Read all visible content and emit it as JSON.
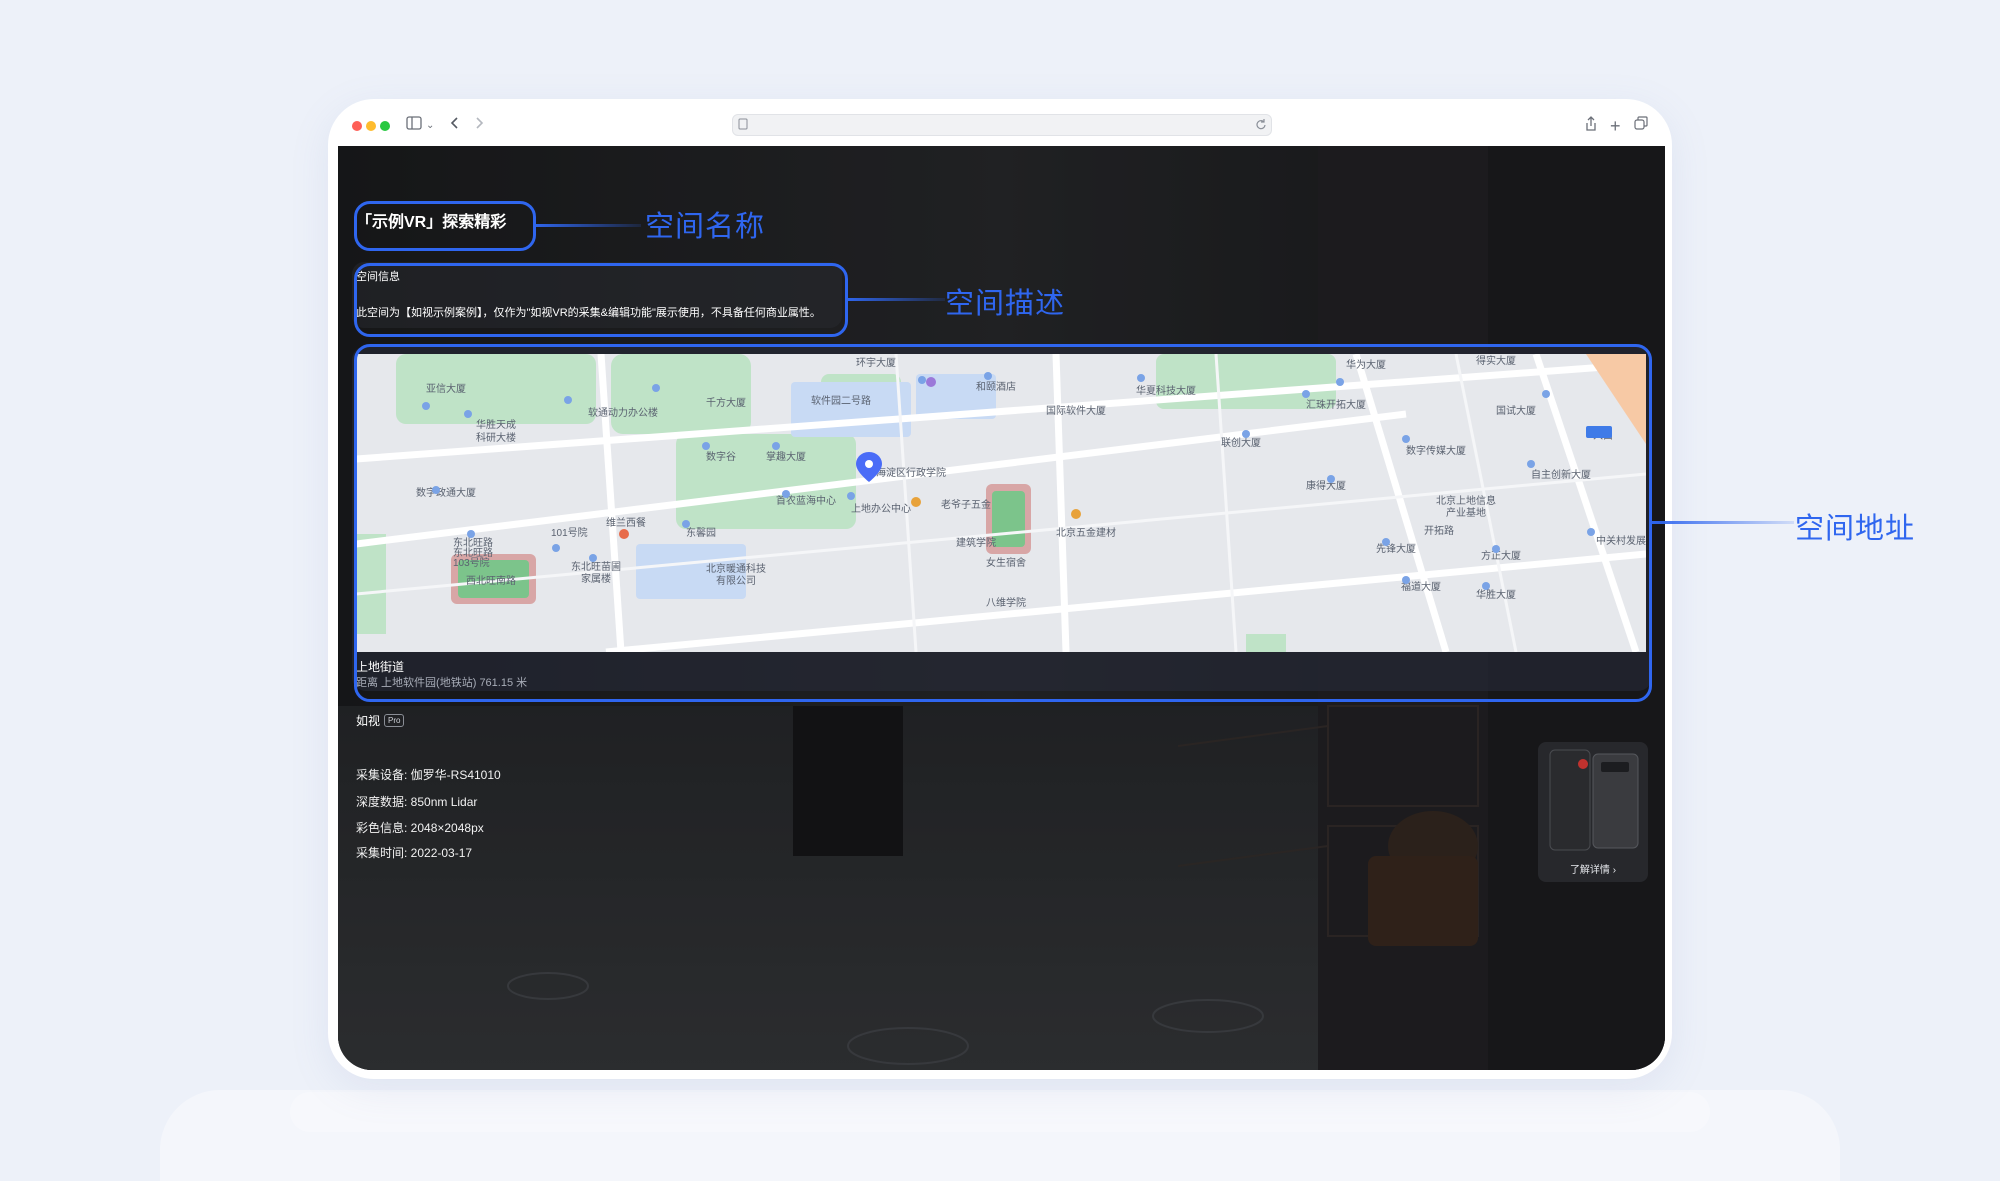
{
  "space": {
    "name": "「示例VR」探索精彩",
    "info_title": "空间信息",
    "description": "此空间为【如视示例案例】，仅作为\"如视VR的采集&编辑功能\"展示使用，不具备任何商业属性。",
    "street": "上地街道",
    "distance": "距离 上地软件园(地铁站) 761.15 米"
  },
  "brand": {
    "name": "如视",
    "badge": "Pro"
  },
  "specs": [
    {
      "text": "采集设备: 伽罗华-RS41010"
    },
    {
      "text": "深度数据: 850nm Lidar"
    },
    {
      "text": "彩色信息: 2048×2048px"
    },
    {
      "text": "采集时间: 2022-03-17"
    }
  ],
  "device_card": {
    "label": "了解详情 ›"
  },
  "annotations": {
    "name": "空间名称",
    "description": "空间描述",
    "address": "空间地址"
  },
  "map": {
    "labels": [
      {
        "id": "l1",
        "text": "亚信大厦"
      },
      {
        "id": "l2",
        "text": "华胜天成"
      },
      {
        "id": "l3",
        "text": "科研大楼"
      },
      {
        "id": "l4",
        "text": "软通动力办公楼"
      },
      {
        "id": "l5",
        "text": "千方大厦"
      },
      {
        "id": "l6",
        "text": "环宇大厦"
      },
      {
        "id": "l7",
        "text": "软件园二号路"
      },
      {
        "id": "l8",
        "text": "和颐酒店"
      },
      {
        "id": "l9",
        "text": "国际软件大厦"
      },
      {
        "id": "l10",
        "text": "华夏科技大厦"
      },
      {
        "id": "l11",
        "text": "华为大厦"
      },
      {
        "id": "l12",
        "text": "得实大厦"
      },
      {
        "id": "l13",
        "text": "汇珠开拓大厦"
      },
      {
        "id": "l14",
        "text": "国试大厦"
      },
      {
        "id": "l15",
        "text": "联创大厦"
      },
      {
        "id": "l16",
        "text": "数字传媒大厦"
      },
      {
        "id": "l17",
        "text": "自主创新大厦"
      },
      {
        "id": "l18",
        "text": "数字谷"
      },
      {
        "id": "l19",
        "text": "掌趣大厦"
      },
      {
        "id": "l20",
        "text": "海淀区行政学院"
      },
      {
        "id": "l21",
        "text": "康得大厦"
      },
      {
        "id": "l22",
        "text": "数字政通大厦"
      },
      {
        "id": "l23",
        "text": "首农蓝海中心"
      },
      {
        "id": "l24",
        "text": "上地办公中心"
      },
      {
        "id": "l25",
        "text": "老爷子五金"
      },
      {
        "id": "l26",
        "text": "北京上地信息"
      },
      {
        "id": "l27",
        "text": "产业基地"
      },
      {
        "id": "l28",
        "text": "维兰西餐"
      },
      {
        "id": "l29",
        "text": "东馨园"
      },
      {
        "id": "l30",
        "text": "101号院"
      },
      {
        "id": "l31",
        "text": "东北旺路"
      },
      {
        "id": "l32",
        "text": "建筑学院"
      },
      {
        "id": "l33",
        "text": "北京五金建材"
      },
      {
        "id": "l34",
        "text": "先锋大厦"
      },
      {
        "id": "l35",
        "text": "方正大厦"
      },
      {
        "id": "l36",
        "text": "中关村发展大厦"
      },
      {
        "id": "l37",
        "text": "东北旺路"
      },
      {
        "id": "l38",
        "text": "103号院"
      },
      {
        "id": "l39",
        "text": "东北旺苗圃"
      },
      {
        "id": "l40",
        "text": "家属楼"
      },
      {
        "id": "l41",
        "text": "北京暖通科技"
      },
      {
        "id": "l42",
        "text": "有限公司"
      },
      {
        "id": "l43",
        "text": "女生宿舍"
      },
      {
        "id": "l44",
        "text": "福道大厦"
      },
      {
        "id": "l45",
        "text": "华胜大厦"
      },
      {
        "id": "l46",
        "text": "西北旺南路"
      },
      {
        "id": "l47",
        "text": "八维学院"
      },
      {
        "id": "l48",
        "text": "开拓路"
      },
      {
        "id": "l49",
        "text": "入口"
      }
    ]
  },
  "colors": {
    "accent": "#2f66ef",
    "map_bg": "#e6e8ec",
    "map_green": "#bfe3c7",
    "map_blue": "#c8daf4",
    "pin": "#4a6cf7"
  },
  "icons": {
    "sidebar": "sidebar-icon",
    "back": "chevron-left-icon",
    "forward": "chevron-right-icon",
    "share": "share-icon",
    "new_tab": "plus-icon",
    "tabs": "tabs-icon",
    "reload": "reload-icon",
    "pin": "map-pin-icon"
  }
}
